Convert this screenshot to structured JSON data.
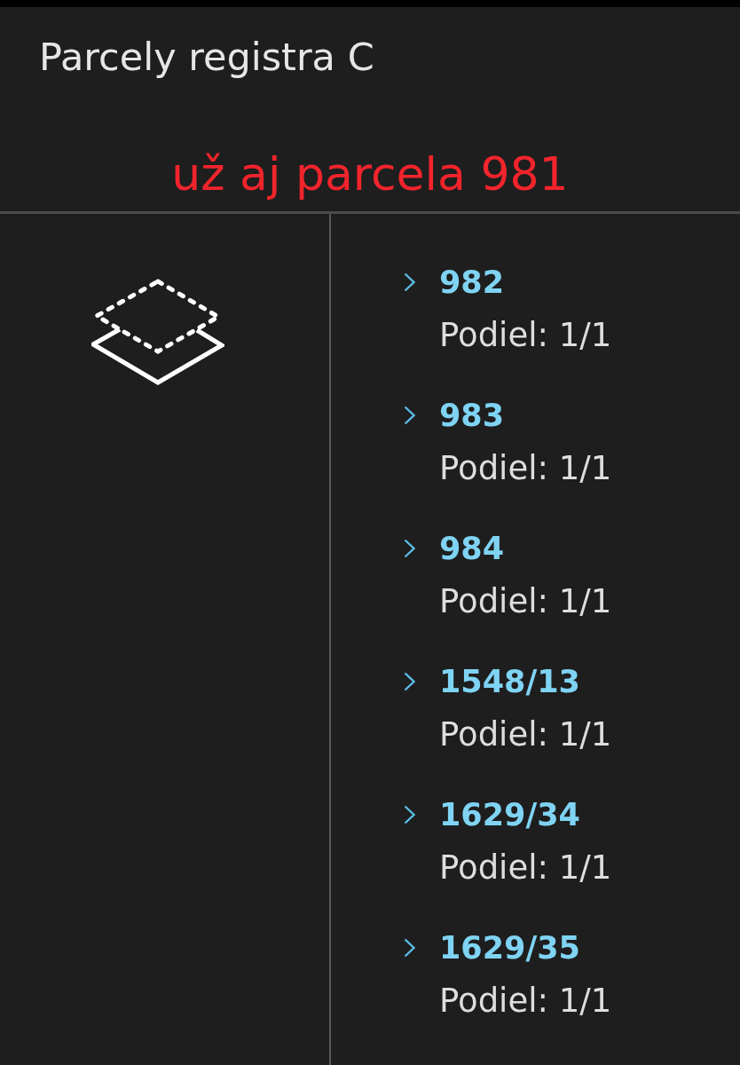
{
  "header": {
    "title": "Parcely registra C"
  },
  "annotation": {
    "text": "už aj parcela 981"
  },
  "parcels": [
    {
      "number": "982",
      "share": "Podiel: 1/1"
    },
    {
      "number": "983",
      "share": "Podiel: 1/1"
    },
    {
      "number": "984",
      "share": "Podiel: 1/1"
    },
    {
      "number": "1548/13",
      "share": "Podiel: 1/1"
    },
    {
      "number": "1629/34",
      "share": "Podiel: 1/1"
    },
    {
      "number": "1629/35",
      "share": "Podiel: 1/1"
    }
  ]
}
